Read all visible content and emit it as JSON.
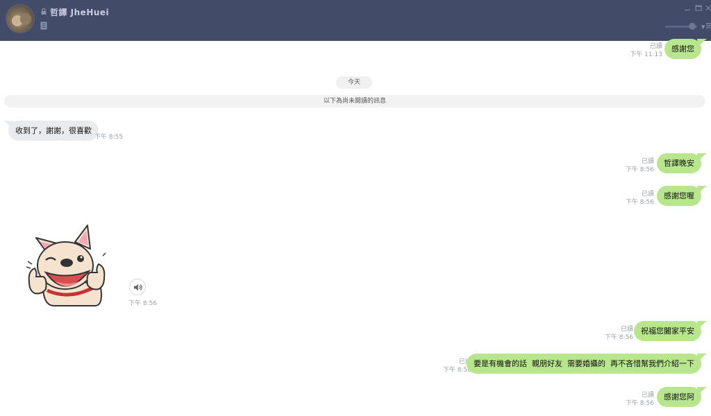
{
  "header": {
    "contact_name": "哲譯 JheHuei"
  },
  "chat": {
    "date_divider": "今天",
    "unread_divider": "以下為尚未閱讀的訊息",
    "messages": [
      {
        "dir": "out",
        "text": "感謝您",
        "read": "已讀",
        "time": "下午 11:13"
      },
      {
        "dir": "in",
        "text": "收到了，謝謝，很喜歡",
        "time": "下午 8:55"
      },
      {
        "dir": "out",
        "text": "哲譯晚安",
        "read": "已讀",
        "time": "下午 8:56"
      },
      {
        "dir": "out",
        "text": "感謝您喔",
        "read": "已讀",
        "time": "下午 8:56"
      },
      {
        "dir": "in",
        "type": "sticker",
        "sticker_icon": "french-bulldog-thumbs-up-sticker",
        "time": "下午 8:56"
      },
      {
        "dir": "out",
        "text": "祝福您闔家平安",
        "read": "已讀",
        "time": "下午 8:56"
      },
      {
        "dir": "out",
        "text": "要是有機會的話  親朋好友  需要婚攝的  再不吝惜幫我們介紹一下",
        "read": "已讀",
        "time": "下午 8:56"
      },
      {
        "dir": "out",
        "text": "感謝您阿",
        "read": "已讀",
        "time": "下午 8:56"
      }
    ]
  },
  "colors": {
    "header_bg": "#424b68",
    "outgoing_bubble": "#b7e68d",
    "incoming_bubble": "#e9ecef",
    "meta_text": "#9aa0a6"
  }
}
